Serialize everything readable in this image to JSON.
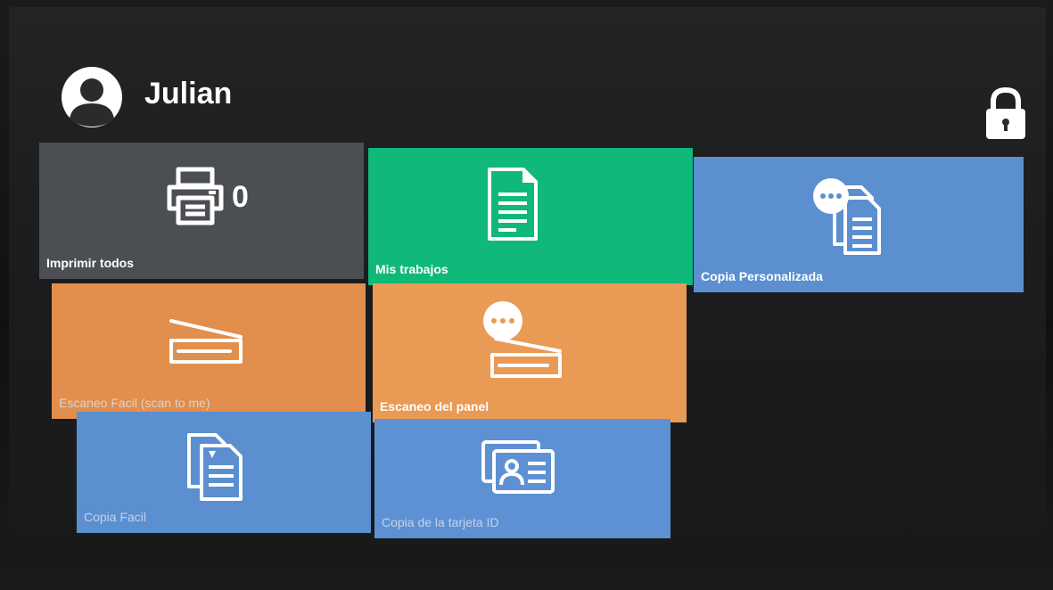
{
  "header": {
    "user_name": "Julian",
    "avatar_icon": "user-avatar-icon",
    "lock_icon": "lock-icon"
  },
  "tiles": [
    {
      "id": "print-all",
      "label": "Imprimir todos",
      "icon": "printer-icon",
      "badge": "0",
      "color": "#4b4e52"
    },
    {
      "id": "my-jobs",
      "label": "Mis trabajos",
      "icon": "document-icon",
      "color": "#10b879"
    },
    {
      "id": "custom-copy",
      "label": "Copia Personalizada",
      "icon": "copy-settings-icon",
      "color": "#5b8fd0"
    },
    {
      "id": "easy-scan",
      "label": "Escaneo Facil (scan to me)",
      "icon": "scanner-icon",
      "color": "#e28e4c"
    },
    {
      "id": "panel-scan",
      "label": "Escaneo del panel",
      "icon": "scanner-settings-icon",
      "color": "#e99a55"
    },
    {
      "id": "easy-copy",
      "label": "Copia Facil",
      "icon": "copy-icon",
      "color": "#5b8fd0"
    },
    {
      "id": "id-card-copy",
      "label": "Copia de la tarjeta ID",
      "icon": "id-card-icon",
      "color": "#5d91d4"
    }
  ]
}
